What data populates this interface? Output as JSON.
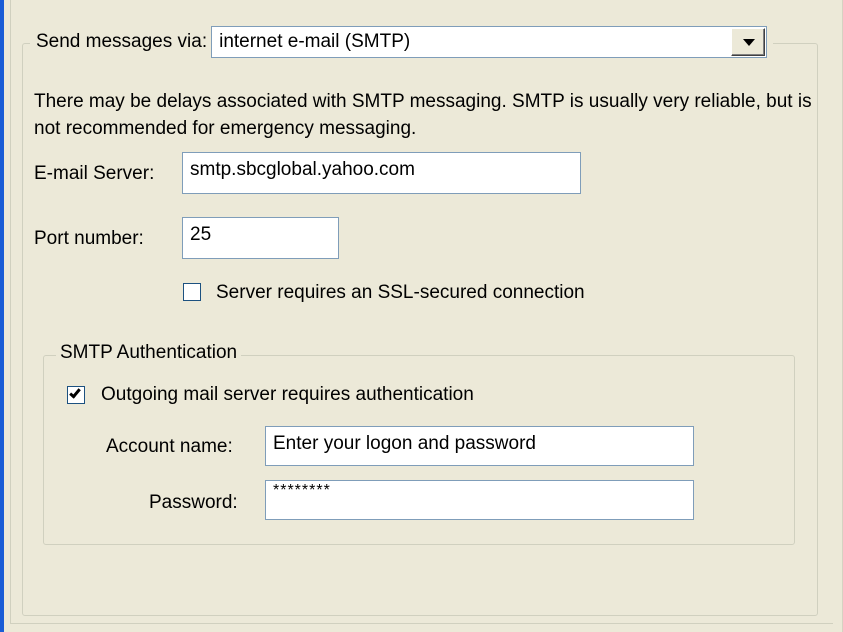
{
  "send_via": {
    "label": "Send messages via:",
    "selected": "internet e-mail (SMTP)"
  },
  "notice": "There may be delays associated with SMTP messaging. SMTP is usually very reliable, but is not recommended for emergency messaging.",
  "email_server": {
    "label": "E-mail Server:",
    "value": "smtp.sbcglobal.yahoo.com"
  },
  "port": {
    "label": "Port number:",
    "value": "25"
  },
  "ssl": {
    "label": "Server requires an SSL-secured connection",
    "checked": false
  },
  "auth": {
    "legend": "SMTP Authentication",
    "requires_auth": {
      "label": "Outgoing mail server requires authentication",
      "checked": true
    },
    "account": {
      "label": "Account name:",
      "value": "Enter your logon and password"
    },
    "password": {
      "label": "Password:",
      "value": "********"
    }
  },
  "colors": {
    "background": "#ece9d8",
    "accent": "#1a5dd6",
    "field_border": "#7f9db9"
  }
}
